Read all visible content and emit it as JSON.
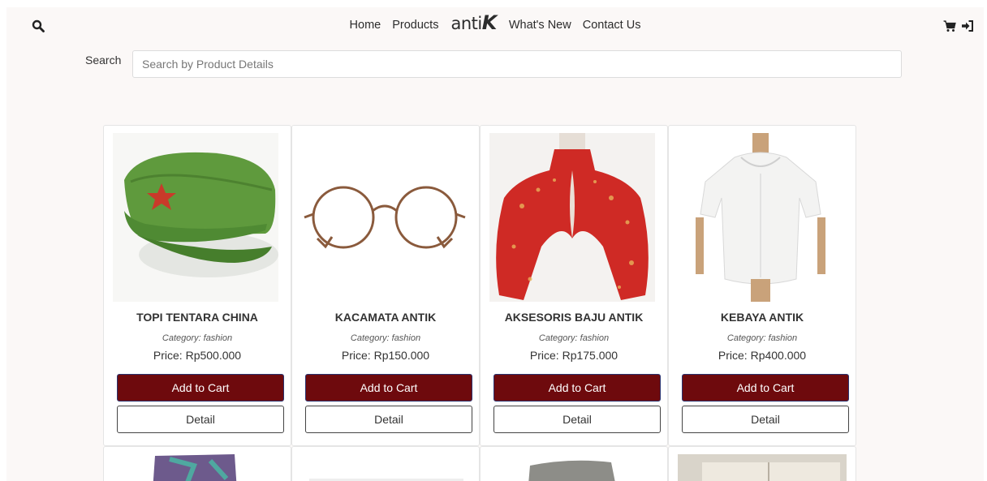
{
  "header": {
    "nav": [
      {
        "label": "Home"
      },
      {
        "label": "Products"
      },
      {
        "label": "What's New"
      },
      {
        "label": "Contact Us"
      }
    ],
    "logo_text_lower": "anti",
    "logo_text_k": "K",
    "icons": [
      "search-icon",
      "cart-icon",
      "sign-in-icon"
    ]
  },
  "search": {
    "label": "Search",
    "placeholder": "Search by Product Details",
    "value": ""
  },
  "products": [
    {
      "title": "TOPI TENTARA CHINA",
      "category": "Category: fashion",
      "price": "Price: Rp500.000",
      "add_label": "Add to Cart",
      "detail_label": "Detail",
      "image": "green-army-cap"
    },
    {
      "title": "KACAMATA ANTIK",
      "category": "Category: fashion",
      "price": "Price: Rp150.000",
      "add_label": "Add to Cart",
      "detail_label": "Detail",
      "image": "round-glasses"
    },
    {
      "title": "AKSESORIS BAJU ANTIK",
      "category": "Category: fashion",
      "price": "Price: Rp175.000",
      "add_label": "Add to Cart",
      "detail_label": "Detail",
      "image": "red-floral-cape"
    },
    {
      "title": "KEBAYA ANTIK",
      "category": "Category: fashion",
      "price": "Price: Rp400.000",
      "add_label": "Add to Cart",
      "detail_label": "Detail",
      "image": "white-lace-blouse"
    }
  ],
  "colors": {
    "page_bg": "#fbf8f7",
    "cart_button": "#6e0a0d",
    "cart_button_border": "#2a3470"
  }
}
